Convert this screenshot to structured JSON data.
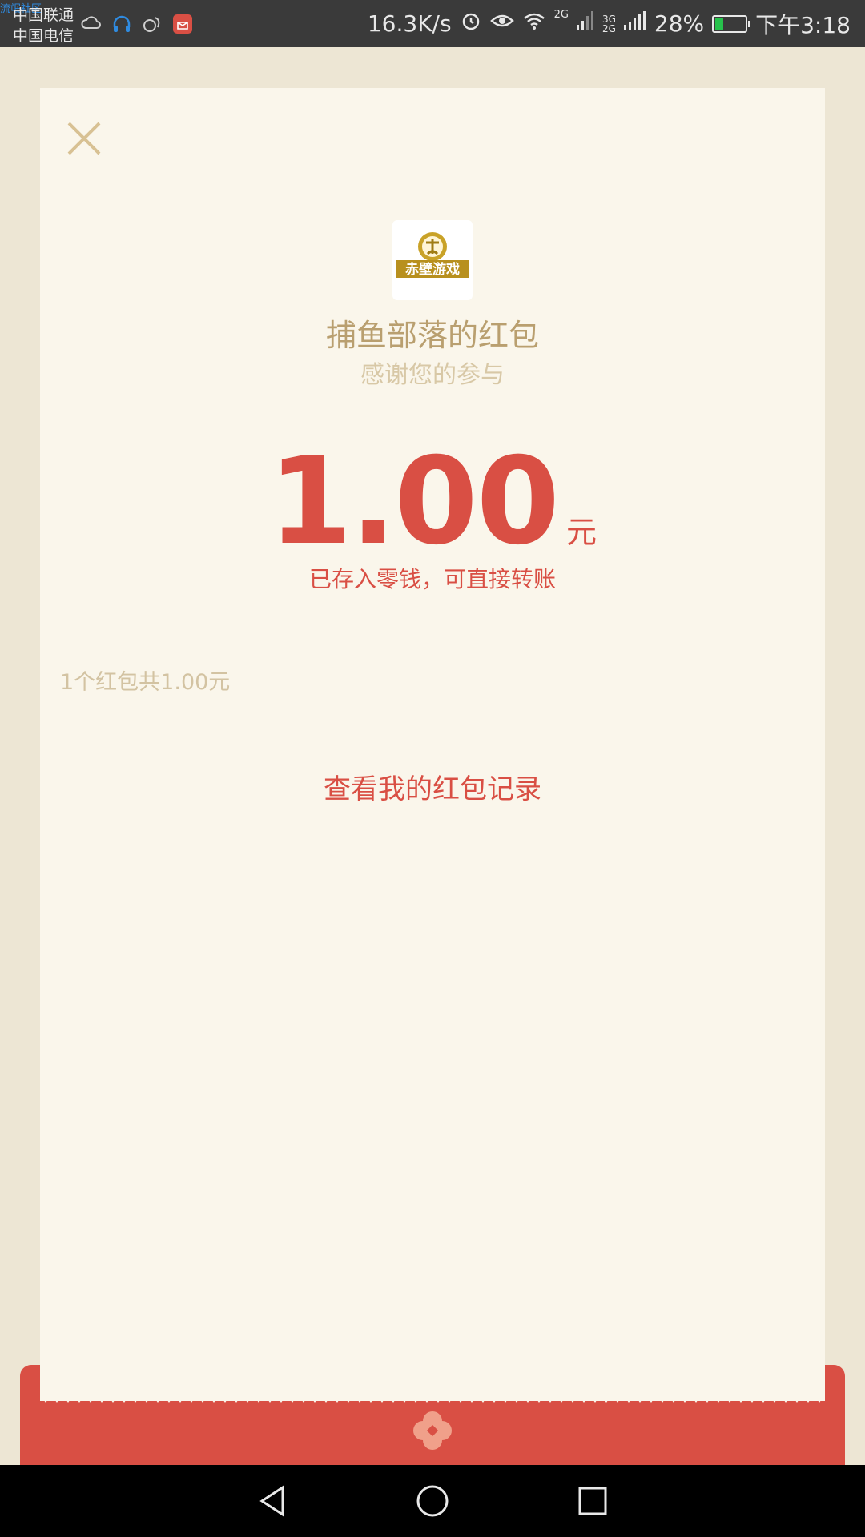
{
  "status_bar": {
    "watermark": "流氓社区",
    "carrier_1": "中国联通",
    "carrier_2": "中国电信",
    "net_speed": "16.3K/s",
    "signal_1": "2G",
    "signal_2_top": "3G",
    "signal_2_bottom": "2G",
    "battery_pct": "28%",
    "battery_level": 0.28,
    "time": "下午3:18"
  },
  "card": {
    "logo_text": "赤壁游戏",
    "title": "捕鱼部落的红包",
    "subtitle": "感谢您的参与",
    "amount": "1.00",
    "unit": "元",
    "deposit_note": "已存入零钱，可直接转账",
    "summary": "1个红包共1.00元",
    "records_link": "查看我的红包记录"
  },
  "colors": {
    "accent_red": "#d94f44",
    "gold": "#b99f6f",
    "card_bg": "#faf6eb",
    "page_bg": "#ede6d4"
  },
  "icons": {
    "close": "close-icon",
    "logo": "app-logo",
    "emblem": "flower-emblem-icon",
    "back": "back-icon",
    "home": "home-icon",
    "recents": "recents-icon"
  }
}
